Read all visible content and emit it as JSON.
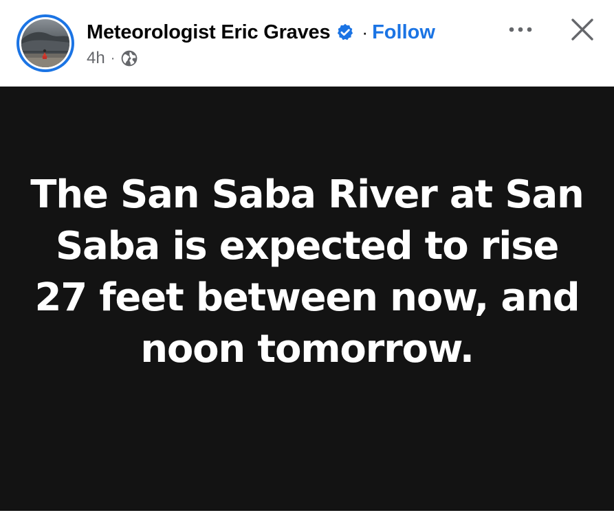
{
  "post": {
    "author": {
      "name": "Meteorologist Eric Graves",
      "verified_icon": "verified-badge-icon",
      "avatar": "storm-avatar"
    },
    "separator": "·",
    "follow_label": "Follow",
    "timestamp": "4h",
    "meta_separator": "·",
    "audience_icon": "globe-icon",
    "more_icon": "more-options-icon",
    "close_icon": "close-icon",
    "text": "The San Saba River at San Saba is expected to rise 27 feet between now, and noon tomorrow."
  },
  "colors": {
    "accent": "#1b74e4",
    "post_background": "#131313",
    "post_text": "#ffffff",
    "name_text": "#050505",
    "meta_text": "#65676b"
  }
}
